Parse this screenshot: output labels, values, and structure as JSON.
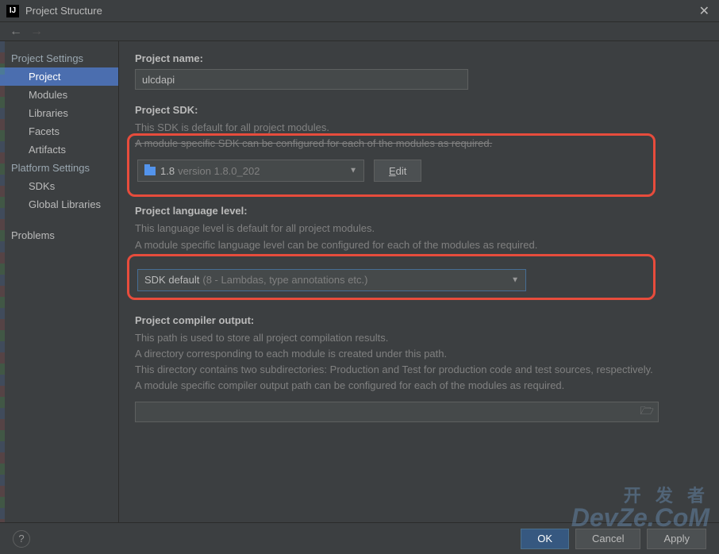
{
  "titlebar": {
    "app_icon": "IJ",
    "title": "Project Structure"
  },
  "sidebar": {
    "project_settings_header": "Project Settings",
    "project_items": [
      "Project",
      "Modules",
      "Libraries",
      "Facets",
      "Artifacts"
    ],
    "platform_settings_header": "Platform Settings",
    "platform_items": [
      "SDKs",
      "Global Libraries"
    ],
    "problems": "Problems"
  },
  "main": {
    "project_name": {
      "label": "Project name:",
      "value": "ulcdapi"
    },
    "project_sdk": {
      "label": "Project SDK:",
      "desc1": "This SDK is default for all project modules.",
      "desc2": "A module specific SDK can be configured for each of the modules as required.",
      "dropdown_main": "1.8",
      "dropdown_sub": "version 1.8.0_202",
      "edit_button": "Edit"
    },
    "language_level": {
      "label": "Project language level:",
      "desc1": "This language level is default for all project modules.",
      "desc2": "A module specific language level can be configured for each of the modules as required.",
      "dropdown_main": "SDK default",
      "dropdown_sub": "(8 - Lambdas, type annotations etc.)"
    },
    "compiler_output": {
      "label": "Project compiler output:",
      "desc1": "This path is used to store all project compilation results.",
      "desc2": "A directory corresponding to each module is created under this path.",
      "desc3": "This directory contains two subdirectories: Production and Test for production code and test sources, respectively.",
      "desc4": "A module specific compiler output path can be configured for each of the modules as required.",
      "value": ""
    }
  },
  "footer": {
    "ok": "OK",
    "cancel": "Cancel",
    "apply": "Apply"
  },
  "watermark": {
    "cn": "开 发 者",
    "en": "DevZe.CoM"
  }
}
